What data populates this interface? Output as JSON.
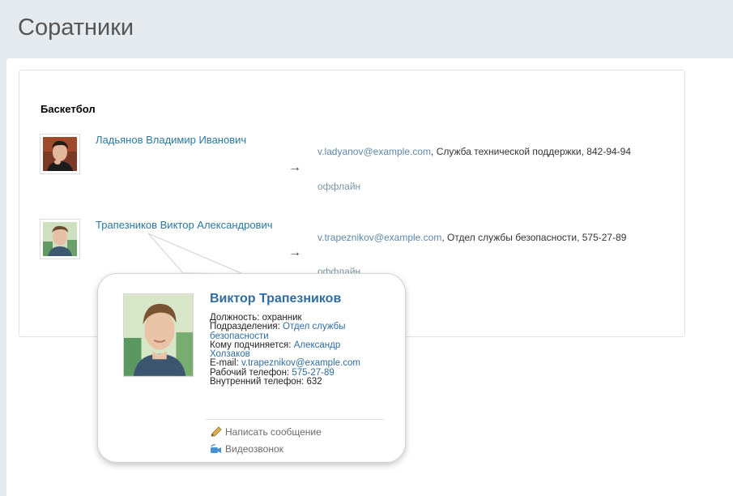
{
  "page": {
    "title": "Соратники"
  },
  "group": {
    "title": "Баскетбол"
  },
  "users": [
    {
      "name": "Ладьянов Владимир Иванович",
      "email": "v.ladyanov@example.com",
      "details": ", Служба технической поддержки, 842-94-94",
      "status": "оффлайн",
      "arrow": "→"
    },
    {
      "name": "Трапезников Виктор Александрович",
      "email": "v.trapeznikov@example.com",
      "details": ", Отдел службы безопасности, 575-27-89",
      "status": "оффлайн",
      "arrow": "→"
    }
  ],
  "popup": {
    "name": "Виктор Трапезников",
    "position_label": "Должность:",
    "position_value": "охранник",
    "department_label": "Подразделения:",
    "department_value": "Отдел службы безопасности",
    "manager_label": "Кому подчиняется:",
    "manager_value": "Александр Холзаков",
    "email_label": "E-mail:",
    "email_value": "v.trapeznikov@example.com",
    "work_phone_label": "Рабочий телефон:",
    "work_phone_value": "575-27-89",
    "internal_phone_label": "Внутренний телефон:",
    "internal_phone_value": "632",
    "action_message": "Написать сообщение",
    "action_video": "Видеозвонок"
  },
  "colors": {
    "link": "#2a78a0",
    "email": "#5d86a8",
    "status": "#7c96a6",
    "popup_name": "#2f6da0"
  },
  "icons": {
    "message": "pencil-icon",
    "video": "video-call-icon"
  }
}
